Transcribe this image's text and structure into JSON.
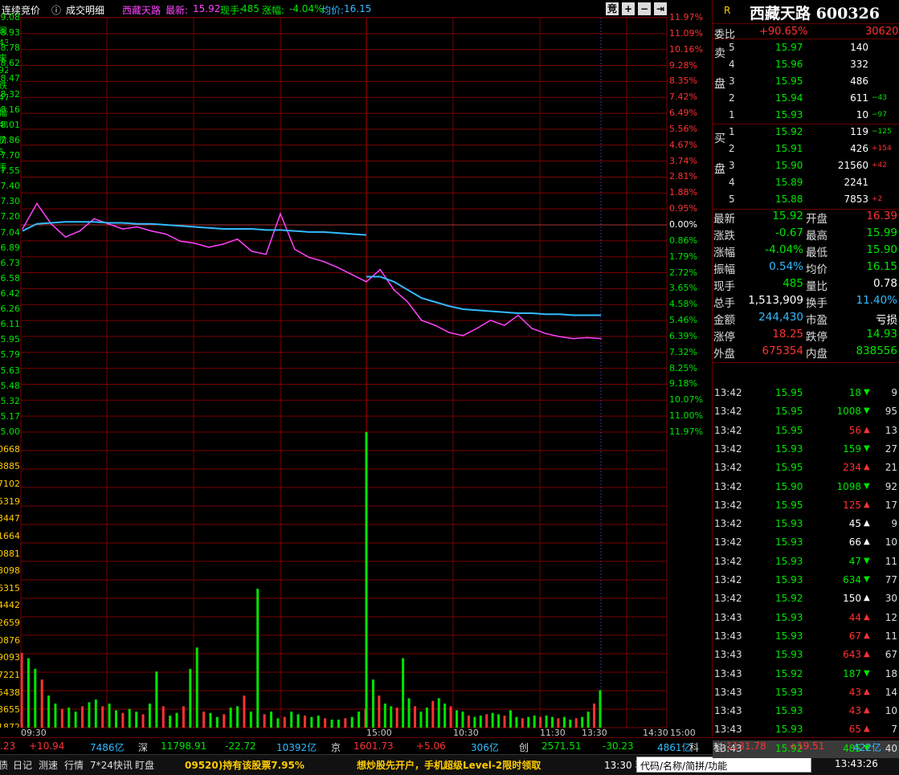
{
  "colors": {
    "up": "#ff3232",
    "down": "#00e600",
    "flat": "#ffffff",
    "avg": "#33bbff",
    "price": "#ff44ff",
    "grid": "#7a0000",
    "label": "#c8c8c8"
  },
  "topbar": {
    "title": "连续竞价",
    "info_icon": "ⓘ",
    "detail_label": "成交明细",
    "stock_name": "西藏天路",
    "latest_label": "最新:",
    "latest_value": "15.92",
    "vol_label": "现手:",
    "vol_value": "485",
    "chg_label": "涨幅:",
    "chg_value": "-4.04%",
    "avg_label": "均价:",
    "avg_value": "16.15",
    "btn_bid": "竞",
    "btn_plus": "+",
    "btn_minus": "−",
    "btn_end": "⇥"
  },
  "left_panel_clipped": [
    "司",
    "43",
    "来",
    "92",
    "跌",
    "47",
    "幅",
    "4%",
    "价",
    "5",
    "手"
  ],
  "price_axis_left": [
    "9.08",
    "8.93",
    "8.78",
    "8.62",
    "8.47",
    "8.32",
    "8.16",
    "8.01",
    "7.86",
    "7.70",
    "7.55",
    "7.40",
    "7.30",
    "7.20",
    "7.04",
    "6.89",
    "6.73",
    "6.58",
    "6.42",
    "6.26",
    "6.11",
    "5.95",
    "5.79",
    "5.63",
    "5.48",
    "5.32",
    "5.17",
    "5.00"
  ],
  "pct_axis_right": [
    "11.97%",
    "11.09%",
    "10.16%",
    "9.28%",
    "8.35%",
    "7.42%",
    "6.49%",
    "5.56%",
    "4.67%",
    "3.74%",
    "2.81%",
    "1.88%",
    "0.95%",
    "0.00%",
    "0.86%",
    "1.79%",
    "2.72%",
    "3.65%",
    "4.58%",
    "5.46%",
    "6.39%",
    "7.32%",
    "8.25%",
    "9.18%",
    "10.07%",
    "11.00%",
    "11.97%"
  ],
  "vol_axis_left": [
    "0668",
    "8885",
    "7102",
    "5319",
    "3447",
    "1664",
    "0881",
    "8098",
    "6315",
    "4442",
    "2659",
    "0876",
    "9093",
    "7221",
    "5438",
    "3655",
    "1872"
  ],
  "time_labels": [
    "09:30",
    "15:00",
    "10:30",
    "11:30",
    "13:30",
    "14:30",
    "15:00"
  ],
  "chart_data": [
    {
      "type": "line",
      "title": "",
      "xlabel": "",
      "ylabel": "",
      "ylim": [
        15.0,
        19.08
      ],
      "prev_close": 17.04,
      "x": [
        "09:30",
        "09:35",
        "09:40",
        "09:45",
        "09:50",
        "09:55",
        "10:00",
        "10:05",
        "10:10",
        "10:15",
        "10:20",
        "10:25",
        "10:30",
        "10:35",
        "10:40",
        "10:45",
        "10:50",
        "10:55",
        "11:00",
        "11:05",
        "11:10",
        "11:15",
        "11:20",
        "11:25",
        "11:30",
        "13:00",
        "13:05",
        "13:10",
        "13:15",
        "13:20",
        "13:25",
        "13:30",
        "13:35",
        "13:40",
        "13:43"
      ],
      "series": [
        {
          "values": [
            17.0,
            17.25,
            17.05,
            16.92,
            16.98,
            17.1,
            17.05,
            17.0,
            17.02,
            16.98,
            16.95,
            16.88,
            16.86,
            16.82,
            16.85,
            16.9,
            16.78,
            16.75,
            17.15,
            16.8,
            16.72,
            16.68,
            16.62,
            16.55,
            16.48,
            16.6,
            16.4,
            16.28,
            16.1,
            16.05,
            15.98,
            15.95,
            16.02,
            16.1,
            16.05,
            16.15,
            16.02,
            15.97,
            15.94,
            15.92,
            15.93,
            15.92
          ]
        },
        {
          "values": [
            16.98,
            17.05,
            17.06,
            17.07,
            17.07,
            17.07,
            17.06,
            17.06,
            17.05,
            17.05,
            17.04,
            17.03,
            17.02,
            17.01,
            17.0,
            17.0,
            17.0,
            16.99,
            16.99,
            16.98,
            16.97,
            16.97,
            16.96,
            16.95,
            16.94,
            16.53,
            16.48,
            16.4,
            16.32,
            16.28,
            16.24,
            16.21,
            16.2,
            16.19,
            16.18,
            16.17,
            16.17,
            16.16,
            16.16,
            16.15,
            16.15,
            16.15
          ]
        }
      ]
    },
    {
      "type": "bar",
      "title": "",
      "ylim": [
        0,
        110668
      ],
      "values": [
        28000,
        26000,
        22000,
        18000,
        12000,
        9000,
        7000,
        7500,
        6000,
        8000,
        9500,
        10500,
        8000,
        9000,
        6500,
        5500,
        7000,
        6000,
        5000,
        9000,
        21000,
        8000,
        4500,
        5500,
        8000,
        22000,
        30000,
        6000,
        5500,
        4000,
        5000,
        7500,
        8000,
        12000,
        6000,
        52000,
        5000,
        6000,
        3500,
        4000,
        6000,
        5000,
        4500,
        4000,
        4500,
        3500,
        3000,
        3000,
        3500,
        4000,
        6000,
        7000,
        110668,
        18000,
        12000,
        9000,
        8000,
        7500,
        26000,
        11000,
        8000,
        6000,
        7500,
        10000,
        11000,
        9000,
        8000,
        6500,
        6000,
        4500,
        4000,
        4500,
        5000,
        5500,
        5000,
        4500,
        6500,
        4000,
        3500,
        4000,
        4500,
        4000,
        4500,
        4000,
        3500,
        4000,
        3000,
        3500,
        4000,
        6000,
        9000,
        14000
      ]
    }
  ],
  "panel": {
    "r_label": "R",
    "stock_name": "西藏天路",
    "code": "600326",
    "weibi_label": "委比",
    "weibi_value": "+90.65%",
    "weibi_count": "30620",
    "sell_side": "卖盘",
    "buy_side": "买盘",
    "sell": [
      {
        "lvl": "5",
        "price": "15.97",
        "vol": "140",
        "delta": ""
      },
      {
        "lvl": "4",
        "price": "15.96",
        "vol": "332",
        "delta": ""
      },
      {
        "lvl": "3",
        "price": "15.95",
        "vol": "486",
        "delta": ""
      },
      {
        "lvl": "2",
        "price": "15.94",
        "vol": "611",
        "delta": "−43"
      },
      {
        "lvl": "1",
        "price": "15.93",
        "vol": "10",
        "delta": "−97"
      }
    ],
    "buy": [
      {
        "lvl": "1",
        "price": "15.92",
        "vol": "119",
        "delta": "−125"
      },
      {
        "lvl": "2",
        "price": "15.91",
        "vol": "426",
        "delta": "+154"
      },
      {
        "lvl": "3",
        "price": "15.90",
        "vol": "21560",
        "delta": "+42"
      },
      {
        "lvl": "4",
        "price": "15.89",
        "vol": "2241",
        "delta": ""
      },
      {
        "lvl": "5",
        "price": "15.88",
        "vol": "7853",
        "delta": "+2"
      }
    ],
    "stats": [
      {
        "l1": "最新",
        "v1": "15.92",
        "l2": "开盘",
        "v2": "16.39"
      },
      {
        "l1": "涨跌",
        "v1": "-0.67",
        "l2": "最高",
        "v2": "15.99"
      },
      {
        "l1": "涨幅",
        "v1": "-4.04%",
        "l2": "最低",
        "v2": "15.90"
      },
      {
        "l1": "振幅",
        "v1": "0.54%",
        "l2": "均价",
        "v2": "16.15"
      },
      {
        "l1": "现手",
        "v1": "485",
        "l2": "量比",
        "v2": "0.78"
      },
      {
        "l1": "总手",
        "v1": "1,513,909",
        "l2": "换手",
        "v2": "11.40%"
      },
      {
        "l1": "金额",
        "v1": "244,430",
        "l2": "市盈",
        "v2": "亏损"
      },
      {
        "l1": "涨停",
        "v1": "18.25",
        "l2": "跌停",
        "v2": "14.93"
      },
      {
        "l1": "外盘",
        "v1": "675354",
        "l2": "内盘",
        "v2": "838556"
      }
    ],
    "trades": [
      {
        "t": "13:42",
        "p": "15.95",
        "v": "18",
        "d": "dn",
        "n": "9"
      },
      {
        "t": "13:42",
        "p": "15.95",
        "v": "1008",
        "d": "dn",
        "n": "95"
      },
      {
        "t": "13:42",
        "p": "15.95",
        "v": "56",
        "d": "up",
        "n": "13"
      },
      {
        "t": "13:42",
        "p": "15.93",
        "v": "159",
        "d": "dn",
        "n": "27"
      },
      {
        "t": "13:42",
        "p": "15.95",
        "v": "234",
        "d": "up",
        "n": "21"
      },
      {
        "t": "13:42",
        "p": "15.90",
        "v": "1098",
        "d": "dn",
        "n": "92"
      },
      {
        "t": "13:42",
        "p": "15.95",
        "v": "125",
        "d": "up",
        "n": "17"
      },
      {
        "t": "13:42",
        "p": "15.93",
        "v": "45",
        "d": "wh",
        "n": "9"
      },
      {
        "t": "13:42",
        "p": "15.93",
        "v": "66",
        "d": "wh",
        "n": "10"
      },
      {
        "t": "13:42",
        "p": "15.93",
        "v": "47",
        "d": "dn",
        "n": "11"
      },
      {
        "t": "13:42",
        "p": "15.93",
        "v": "634",
        "d": "dn",
        "n": "77"
      },
      {
        "t": "13:42",
        "p": "15.92",
        "v": "150",
        "d": "wh",
        "n": "30"
      },
      {
        "t": "13:43",
        "p": "15.93",
        "v": "44",
        "d": "up",
        "n": "12"
      },
      {
        "t": "13:43",
        "p": "15.93",
        "v": "67",
        "d": "up",
        "n": "11"
      },
      {
        "t": "13:43",
        "p": "15.93",
        "v": "643",
        "d": "up",
        "n": "67"
      },
      {
        "t": "13:43",
        "p": "15.92",
        "v": "187",
        "d": "dn",
        "n": "18"
      },
      {
        "t": "13:43",
        "p": "15.93",
        "v": "43",
        "d": "up",
        "n": "14"
      },
      {
        "t": "13:43",
        "p": "15.93",
        "v": "43",
        "d": "up",
        "n": "10"
      },
      {
        "t": "13:43",
        "p": "15.93",
        "v": "65",
        "d": "up",
        "n": "7"
      },
      {
        "t": "13:43",
        "p": "15.92",
        "v": "485",
        "d": "dn",
        "n": "40"
      }
    ]
  },
  "index_bar": [
    {
      "text": ".23",
      "color": "#ff3232"
    },
    {
      "text": "+10.94",
      "color": "#ff3232"
    },
    {
      "text": "7486亿",
      "color": "#33bbff"
    },
    {
      "text": "深",
      "color": "#dddddd"
    },
    {
      "text": "11798.91",
      "color": "#00e600"
    },
    {
      "text": "-22.72",
      "color": "#00e600"
    },
    {
      "text": "10392亿",
      "color": "#33bbff"
    },
    {
      "text": "京",
      "color": "#dddddd"
    },
    {
      "text": "1601.73",
      "color": "#ff3232"
    },
    {
      "text": "+5.06",
      "color": "#ff3232"
    },
    {
      "text": "306亿",
      "color": "#33bbff"
    },
    {
      "text": "创",
      "color": "#dddddd"
    },
    {
      "text": "2571.51",
      "color": "#00e600"
    },
    {
      "text": "-30.23",
      "color": "#00e600"
    },
    {
      "text": "4861亿",
      "color": "#33bbff"
    },
    {
      "text": "科",
      "color": "#dddddd"
    },
    {
      "text": "1131.78",
      "color": "#ff3232"
    },
    {
      "text": "+19.51",
      "color": "#ff3232"
    },
    {
      "text": "422亿",
      "color": "#33bbff"
    }
  ],
  "statusbar": {
    "buttons": [
      "债",
      "日记",
      "测速",
      "行情",
      "7*24快讯",
      "盯盘"
    ],
    "ticker1": "09520)持有该股票7.95%",
    "ticker2": "想炒股先开户，手机超级Level-2限时领取",
    "ticker3": "13:30 乳业",
    "search_placeholder": "代码/名称/简拼/功能",
    "clock": "13:43:26"
  }
}
